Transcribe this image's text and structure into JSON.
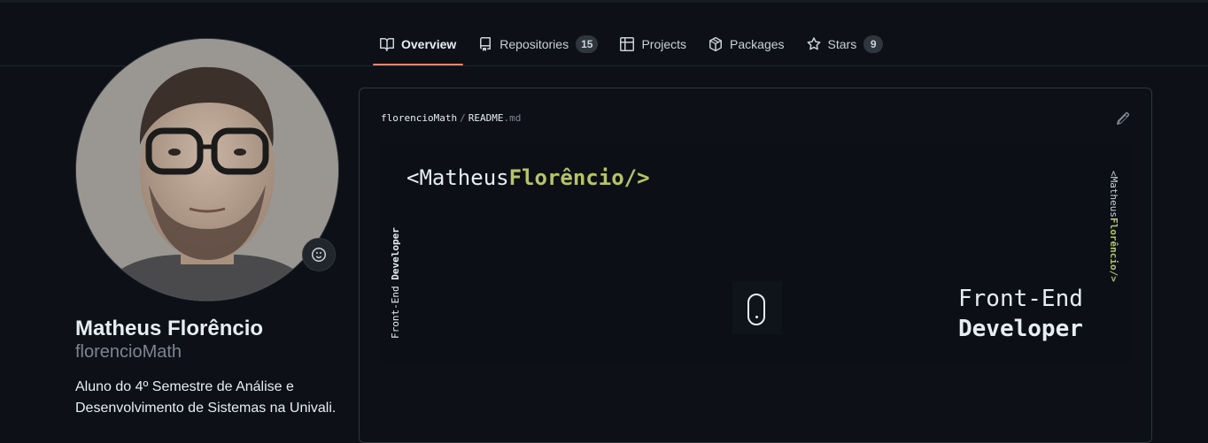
{
  "tabs": {
    "overview": {
      "label": "Overview",
      "icon": "book-icon"
    },
    "repositories": {
      "label": "Repositories",
      "count": "15",
      "icon": "repo-icon"
    },
    "projects": {
      "label": "Projects",
      "icon": "table-icon"
    },
    "packages": {
      "label": "Packages",
      "icon": "package-icon"
    },
    "stars": {
      "label": "Stars",
      "count": "9",
      "icon": "star-icon"
    }
  },
  "profile": {
    "full_name": "Matheus Florêncio",
    "username": "florencioMath",
    "bio": "Aluno do 4º Semestre de Análise e Desenvolvimento de Sistemas na Univali."
  },
  "readme": {
    "owner": "florencioMath",
    "separator": "/",
    "file_base": "README",
    "file_ext": ".md"
  },
  "banner": {
    "name_prefix": "<Matheus",
    "name_accent": "Florêncio/>",
    "left_vertical_light": "Front-End ",
    "left_vertical_bold": "Developer",
    "right_vertical_prefix": "<Matheus",
    "right_vertical_accent": "Florêncio/>",
    "role_line1": "Front-End",
    "role_line2": "Developer"
  },
  "colors": {
    "background": "#0d1117",
    "border": "#30363d",
    "selected_tab_underline": "#f78166",
    "banner_accent": "#b5c46a"
  }
}
